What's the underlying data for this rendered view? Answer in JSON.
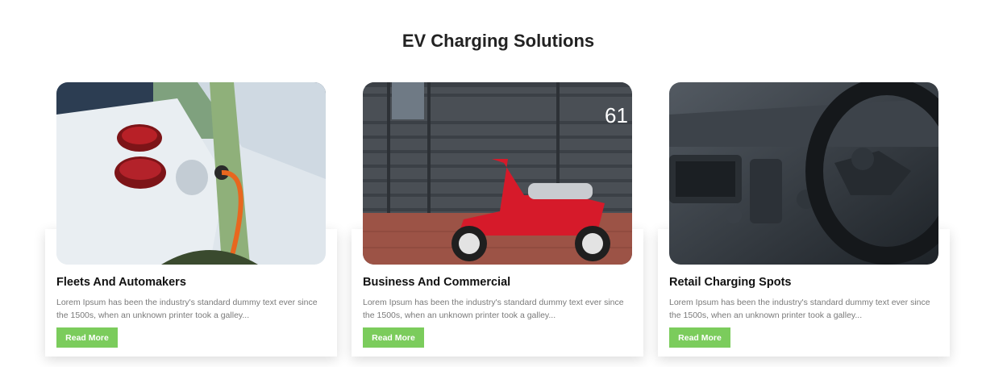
{
  "section": {
    "title": "EV Charging Solutions"
  },
  "cards": [
    {
      "title": "Fleets And Automakers",
      "text": "Lorem Ipsum has been the industry's standard dummy text ever since the 1500s, when an unknown printer took a galley...",
      "button": "Read More"
    },
    {
      "title": "Business And Commercial",
      "text": "Lorem Ipsum has been the industry's standard dummy text ever since the 1500s, when an unknown printer took a galley...",
      "button": "Read More",
      "photo_text": "61"
    },
    {
      "title": "Retail Charging Spots",
      "text": "Lorem Ipsum has been the industry's standard dummy text ever since the 1500s, when an unknown printer took a galley...",
      "button": "Read More"
    }
  ],
  "colors": {
    "accent": "#7bcc5c",
    "title": "#222222",
    "body_text": "#7a7a7a"
  }
}
